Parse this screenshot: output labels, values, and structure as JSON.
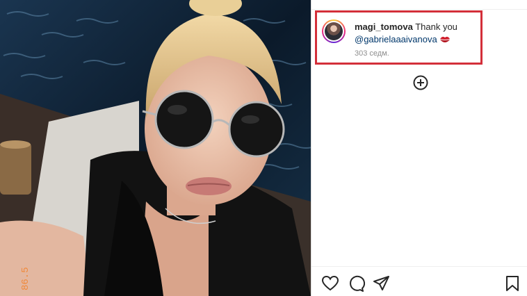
{
  "post": {
    "image_alt": "Selfie photo"
  },
  "comment": {
    "username": "magi_tomova",
    "text": "Thank you",
    "mention": "@gabrielaaaivanova",
    "emoji": "kiss-mark",
    "time": "303 седм."
  },
  "icons": {
    "load_more": "plus-circle-icon",
    "like": "heart-icon",
    "comment": "comment-icon",
    "share": "send-icon",
    "save": "bookmark-icon"
  },
  "colors": {
    "highlight": "#d32f3a",
    "mention": "#00376b",
    "muted": "#8e8e8e",
    "text": "#262626"
  }
}
